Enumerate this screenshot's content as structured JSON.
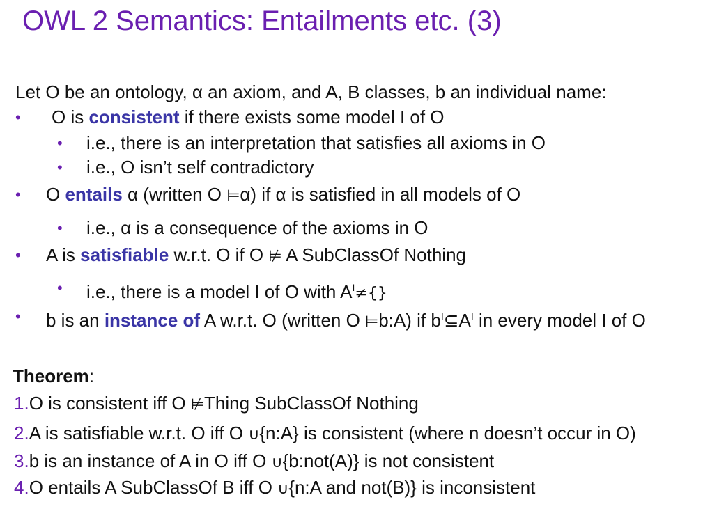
{
  "slide": {
    "title": "OWL 2 Semantics: Entailments etc. (3)",
    "intro": "Let O be an ontology, α an axiom, and A, B classes, b an individual name:",
    "bullet_char": "•",
    "consistent": {
      "pre": "O is ",
      "kw": "consistent",
      "post": " if there exists some model I of O",
      "sub1": "i.e., there is an interpretation that satisfies all axioms in O",
      "sub2": "i.e., O isn’t self contradictory"
    },
    "entails": {
      "pre": "O ",
      "kw": "entails",
      "post1": " α (written O ",
      "sym": "⊨",
      "post2": "α) if α is satisfied in all models of O",
      "sub1": "i.e., α is a consequence of the axioms in O"
    },
    "satisfiable": {
      "pre": "A is ",
      "kw": "satisfiable",
      "post1": " w.r.t. O if O ",
      "sym": "⊭",
      "post2": " A SubClassOf Nothing",
      "sub1_pre": "i.e., there is a model I of O with A",
      "sub1_sup": "I",
      "sub1_post": "≠{}"
    },
    "instance": {
      "pre": "b is an ",
      "kw": "instance of",
      "post1": " A w.r.t. O (written O ",
      "sym": "⊨",
      "post2": "b:A) if b",
      "sup1": "I",
      "mid": "⊆A",
      "sup2": "I",
      "post3": " in every model I of O"
    },
    "theorem": {
      "head": "Theorem",
      "colon": ":",
      "items": [
        {
          "num": "1.",
          "pre": "O is consistent iff O ",
          "sym": "⊭",
          "post": "Thing SubClassOf Nothing"
        },
        {
          "num": "2.",
          "pre": "A is satisfiable w.r.t. O iff O ",
          "sym": "∪",
          "post": "{n:A} is consistent (where n doesn’t occur in O)"
        },
        {
          "num": "3.",
          "pre": "b is an instance of A in O iff O ",
          "sym": "∪",
          "post": "{b:not(A)} is not consistent"
        },
        {
          "num": "4.",
          "pre": "O entails A SubClassOf B iff O ",
          "sym": "∪",
          "post": "{n:A and not(B)} is inconsistent"
        }
      ]
    },
    "colors": {
      "title": "#6a1fb0",
      "keyword": "#3a35a6",
      "text": "#111111"
    }
  }
}
